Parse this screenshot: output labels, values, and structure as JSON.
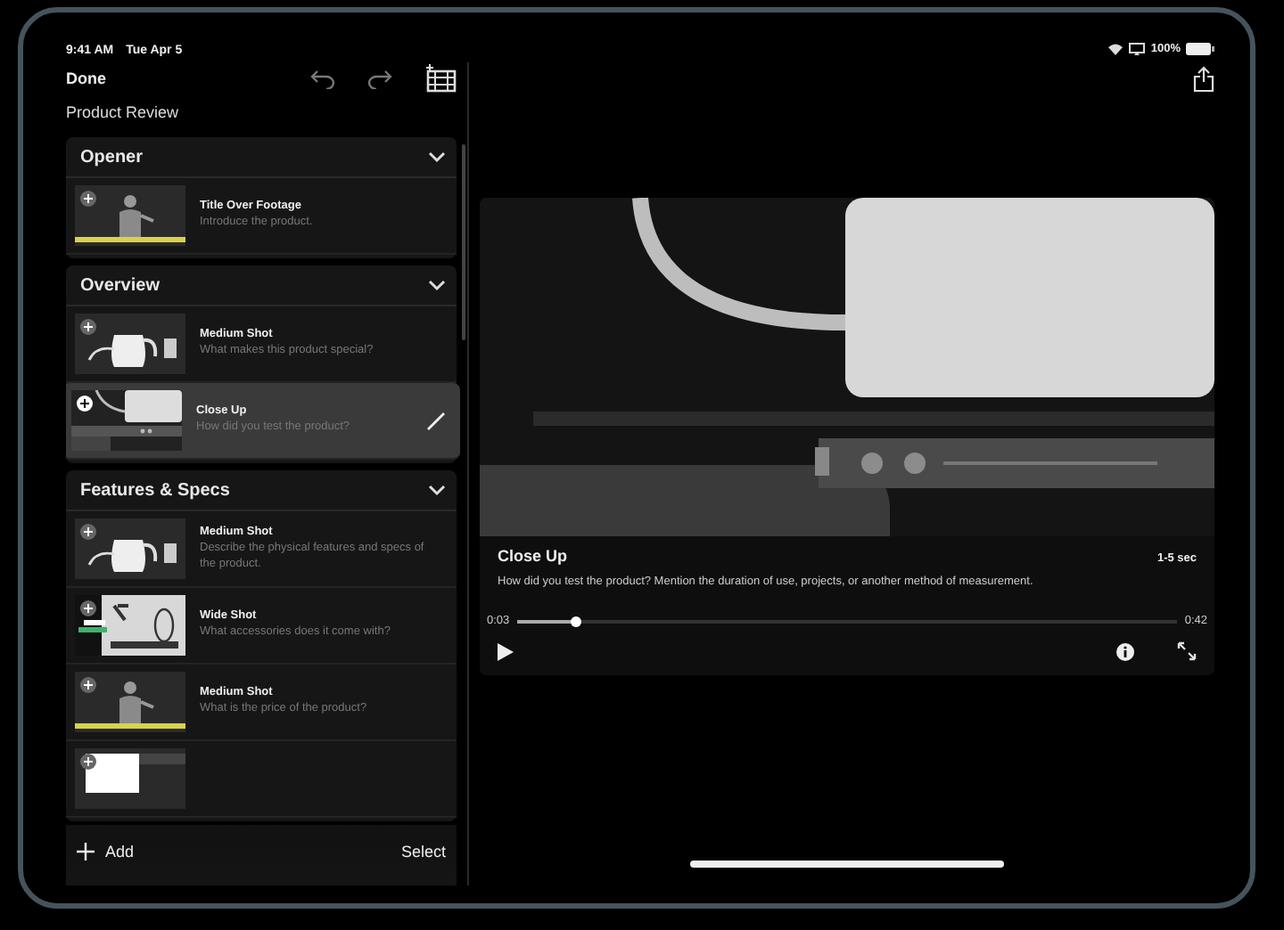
{
  "status_bar": {
    "time": "9:41 AM",
    "date": "Tue Apr 5",
    "battery": "100%"
  },
  "toolbar": {
    "done": "Done"
  },
  "project_title": "Product Review",
  "sections": [
    {
      "title": "Opener",
      "expanded": true,
      "shots": [
        {
          "kind": "presenter",
          "title": "Title Over Footage",
          "description": "Introduce the product.",
          "selected": false
        }
      ]
    },
    {
      "title": "Overview",
      "expanded": true,
      "shots": [
        {
          "kind": "kettle",
          "title": "Medium Shot",
          "description": "What makes this product special?",
          "selected": false
        },
        {
          "kind": "closeup",
          "title": "Close Up",
          "description": "How did you test the product?",
          "selected": true
        }
      ]
    },
    {
      "title": "Features & Specs",
      "expanded": true,
      "shots": [
        {
          "kind": "kettle",
          "title": "Medium Shot",
          "description": "Describe the physical features and specs of the product.",
          "selected": false
        },
        {
          "kind": "accessories",
          "title": "Wide Shot",
          "description": "What accessories does it come with?",
          "selected": false
        },
        {
          "kind": "presenter",
          "title": "Medium Shot",
          "description": "What is the price of the product?",
          "selected": false
        },
        {
          "kind": "box",
          "selected": false
        }
      ]
    }
  ],
  "bottom_bar": {
    "add": "Add",
    "select": "Select"
  },
  "preview": {
    "title": "Close Up",
    "duration": "1-5 sec",
    "prompt": "How did you test the product? Mention the duration of use, projects, or another method of measurement.",
    "elapsed": "0:03",
    "total": "0:42",
    "level": 0.09
  }
}
